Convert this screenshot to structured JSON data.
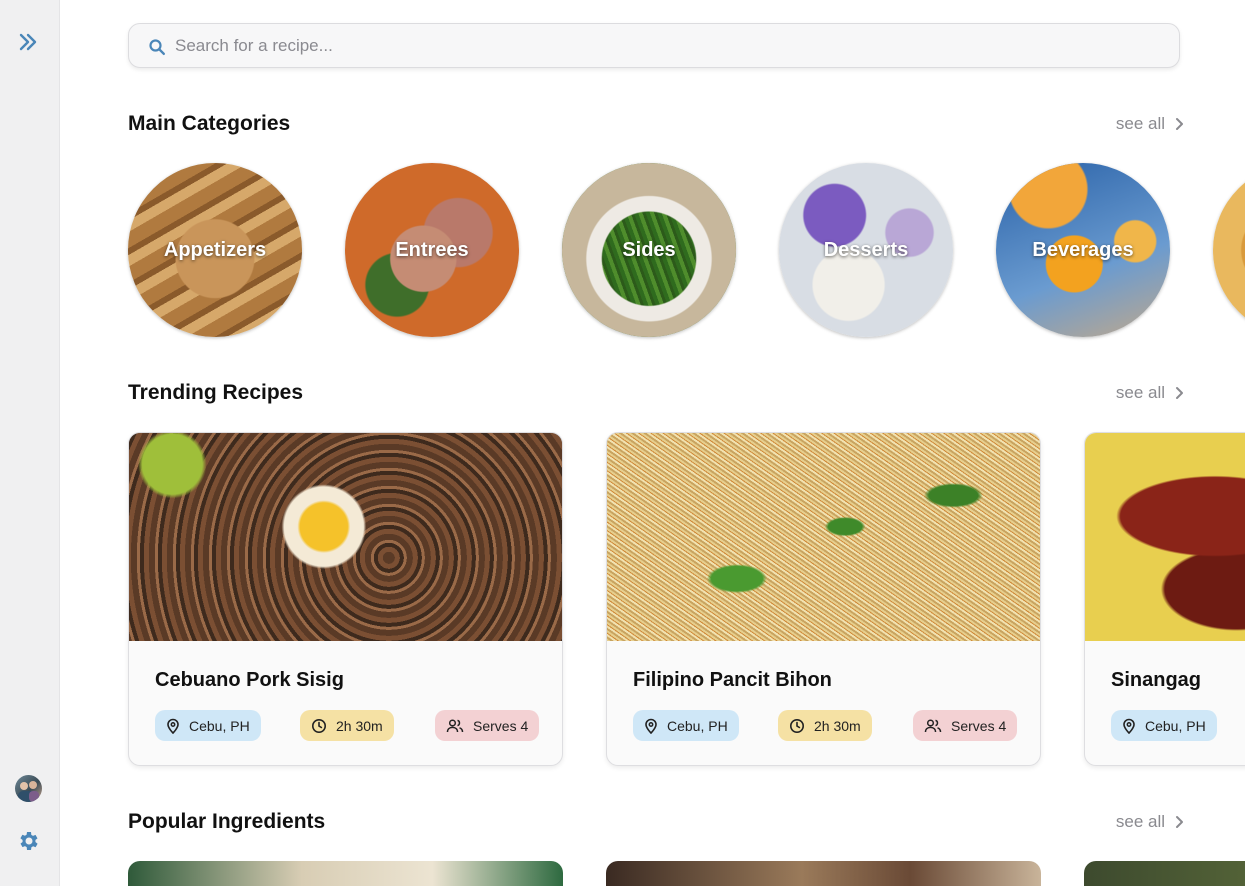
{
  "search": {
    "placeholder": "Search for a recipe..."
  },
  "sections": {
    "categories": {
      "title": "Main Categories",
      "see_all": "see all"
    },
    "trending": {
      "title": "Trending Recipes",
      "see_all": "see all"
    },
    "ingredients": {
      "title": "Popular Ingredients",
      "see_all": "see all"
    }
  },
  "categories": [
    {
      "label": "Appetizers"
    },
    {
      "label": "Entrees"
    },
    {
      "label": "Sides"
    },
    {
      "label": "Desserts"
    },
    {
      "label": "Beverages"
    }
  ],
  "recipes": [
    {
      "name": "Cebuano Pork Sisig",
      "location": "Cebu, PH",
      "time": "2h 30m",
      "serves": "Serves 4"
    },
    {
      "name": "Filipino Pancit Bihon",
      "location": "Cebu, PH",
      "time": "2h 30m",
      "serves": "Serves 4"
    },
    {
      "name": "Sinangag",
      "location": "Cebu, PH"
    }
  ],
  "colors": {
    "accent": "#4a86b8",
    "location_chip": "#cfe7f7",
    "time_chip": "#f5e1a4",
    "serves_chip": "#f3d1d3"
  },
  "icons": {
    "sidebar_expand": "double-chevron-right-icon",
    "settings": "gear-icon",
    "search": "search-icon",
    "location": "map-pin-icon",
    "time": "clock-icon",
    "serves": "users-icon",
    "see_all": "chevron-right-icon"
  }
}
